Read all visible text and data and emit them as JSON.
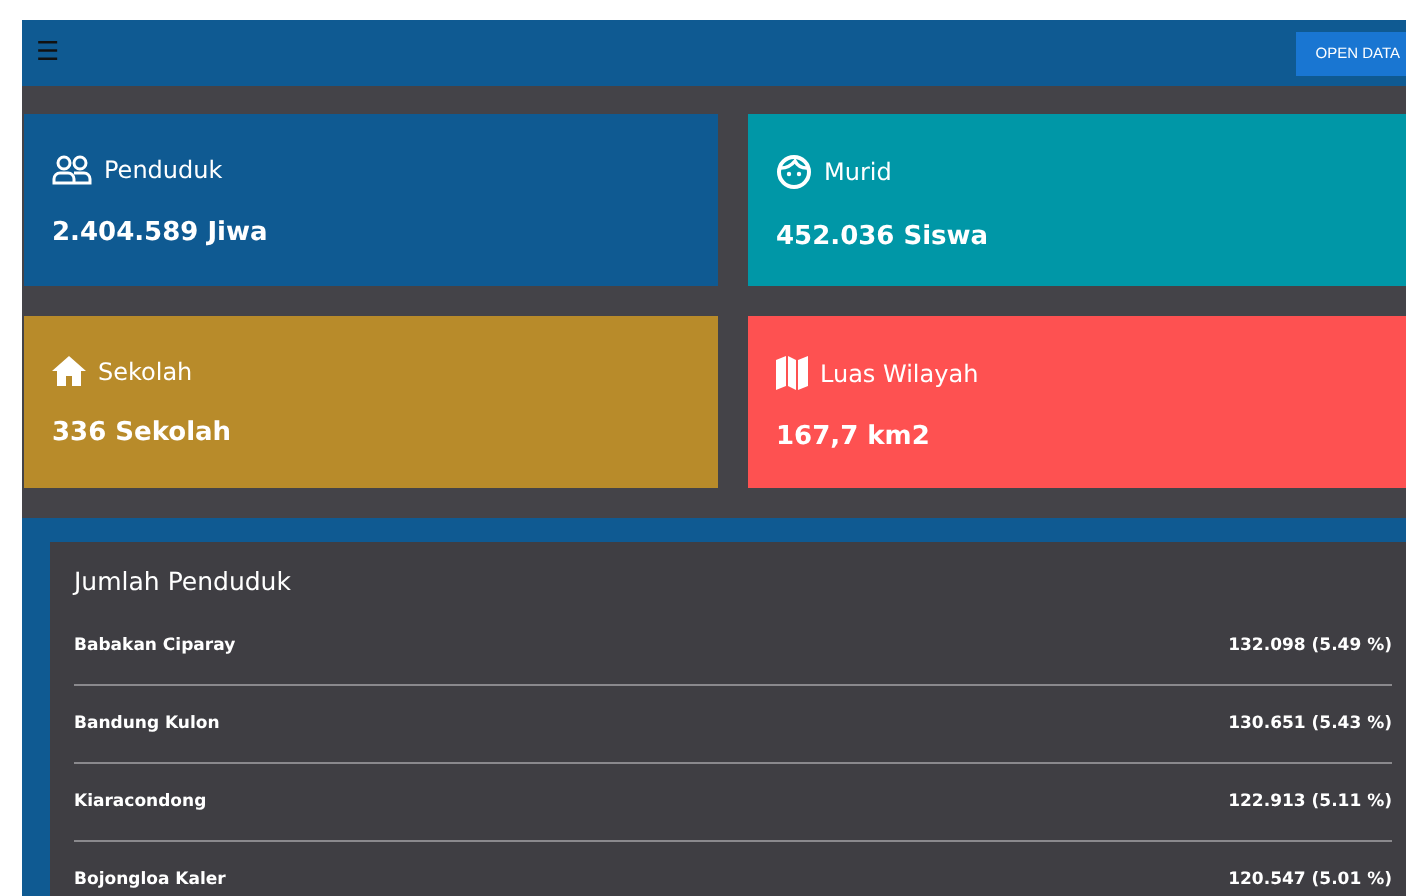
{
  "app_bar": {
    "menu_icon": "☰",
    "button": "OPEN DATA"
  },
  "stats": [
    {
      "kind": "people",
      "label": "Penduduk",
      "value": "2.404.589 Jiwa",
      "color": "#0f5a92"
    },
    {
      "kind": "face",
      "label": "Murid",
      "value": "452.036 Siswa",
      "color": "#0097a7"
    },
    {
      "kind": "home",
      "label": "Sekolah",
      "value": "336 Sekolah",
      "color": "#b88b2a"
    },
    {
      "kind": "map",
      "label": "Luas Wilayah",
      "value": "167,7 km2",
      "color": "#fe5151"
    }
  ],
  "population": {
    "title": "Jumlah Penduduk",
    "rows": [
      {
        "name": "Babakan Ciparay",
        "value": "132.098 (5.49 %)"
      },
      {
        "name": "Bandung Kulon",
        "value": "130.651 (5.43 %)"
      },
      {
        "name": "Kiaracondong",
        "value": "122.913 (5.11 %)"
      },
      {
        "name": "Bojongloa Kaler",
        "value": "120.547 (5.01 %)"
      }
    ]
  }
}
